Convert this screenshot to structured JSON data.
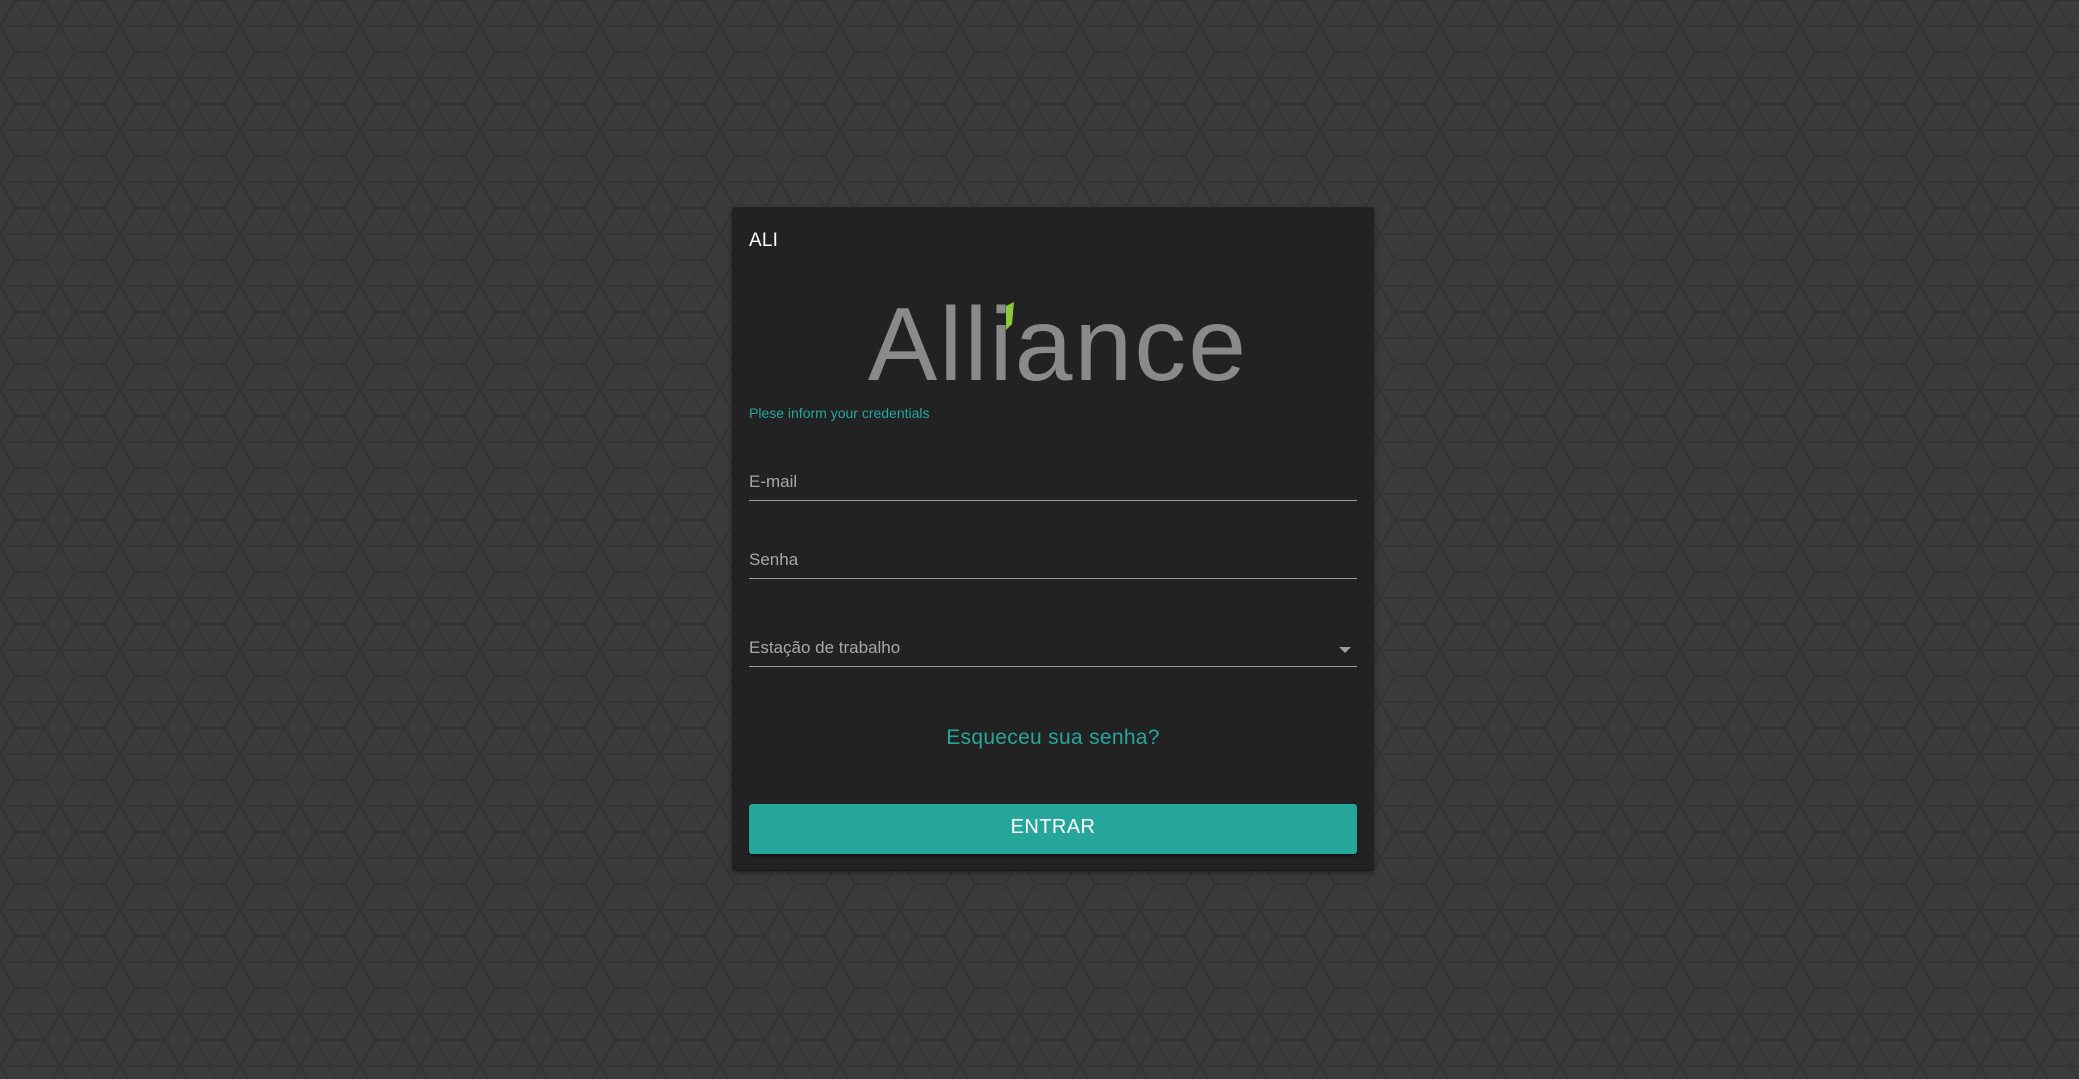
{
  "app": {
    "card_title": "ALI",
    "logo_text": "Alliance",
    "subtitle": "Plese inform your credentials"
  },
  "form": {
    "email_label": "E-mail",
    "email_value": "",
    "senha_label": "Senha",
    "senha_value": "",
    "estacao_label": "Estação de trabalho",
    "estacao_selected": ""
  },
  "actions": {
    "forgot_label": "Esqueceu sua senha?",
    "submit_label": "ENTRAR"
  },
  "colors": {
    "accent": "#26a69a",
    "logo_leaf": "#8dc63f",
    "logo_text": "#8a8a8a",
    "card_bg": "#222222",
    "page_bg": "#3a3a3a"
  },
  "icons": {
    "select_caret": "chevron-down-icon"
  }
}
